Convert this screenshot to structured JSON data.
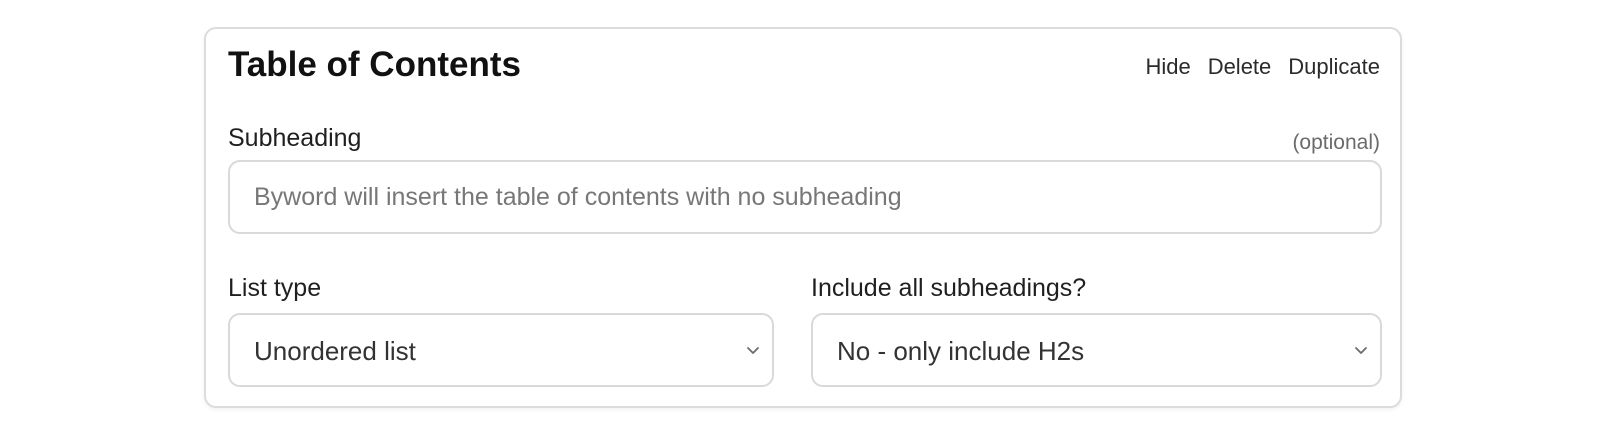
{
  "card": {
    "title": "Table of Contents",
    "actions": {
      "hide": "Hide",
      "delete": "Delete",
      "duplicate": "Duplicate"
    }
  },
  "subheading": {
    "label": "Subheading",
    "optional": "(optional)",
    "value": "",
    "placeholder": "Byword will insert the table of contents with no subheading"
  },
  "list_type": {
    "label": "List type",
    "selected": "Unordered list"
  },
  "include_subheadings": {
    "label": "Include all subheadings?",
    "selected": "No - only include H2s"
  },
  "icons": {
    "select_arrow": "chevron-down-icon"
  }
}
